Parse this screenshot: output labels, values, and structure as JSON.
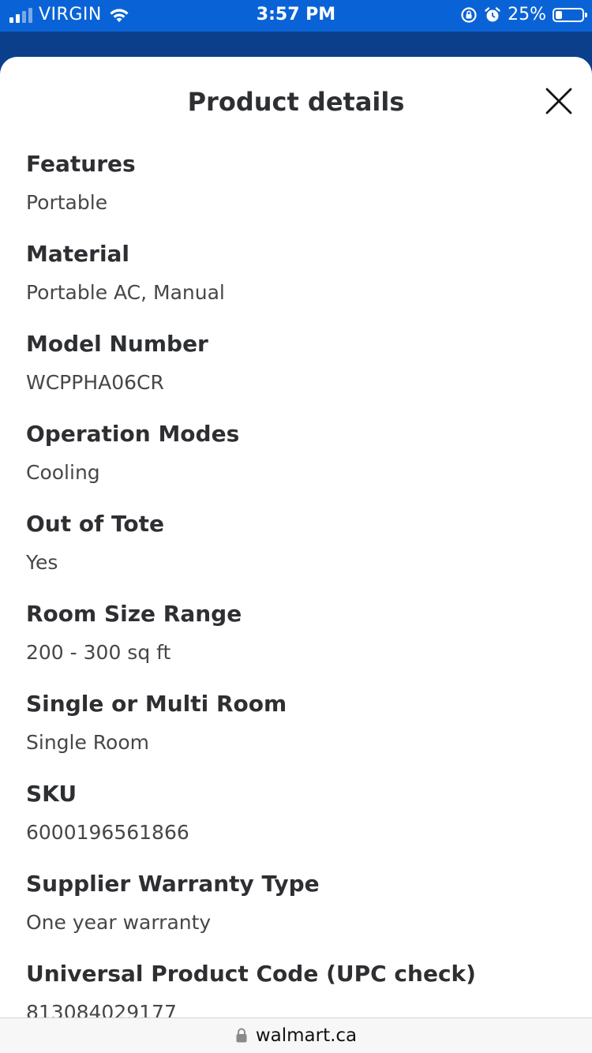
{
  "status_bar": {
    "carrier": "VIRGIN",
    "time": "3:57 PM",
    "battery_percent": "25%",
    "battery_level": 0.25
  },
  "sheet": {
    "title": "Product details",
    "details": [
      {
        "label": "Features",
        "value": "Portable"
      },
      {
        "label": "Material",
        "value": "Portable AC, Manual"
      },
      {
        "label": "Model Number",
        "value": "WCPPHA06CR"
      },
      {
        "label": "Operation Modes",
        "value": "Cooling"
      },
      {
        "label": "Out of Tote",
        "value": "Yes"
      },
      {
        "label": "Room Size Range",
        "value": "200 - 300 sq ft"
      },
      {
        "label": "Single or Multi Room",
        "value": "Single Room"
      },
      {
        "label": "SKU",
        "value": "6000196561866"
      },
      {
        "label": "Supplier Warranty Type",
        "value": "One year warranty"
      },
      {
        "label": "Universal Product Code (UPC check)",
        "value": "813084029177"
      }
    ]
  },
  "url_bar": {
    "domain": "walmart.ca"
  },
  "colors": {
    "status_bar_bg": "#0a63d6",
    "header_bg": "#0b3f8c",
    "label_text": "#2e2f32",
    "value_text": "#46474a"
  }
}
